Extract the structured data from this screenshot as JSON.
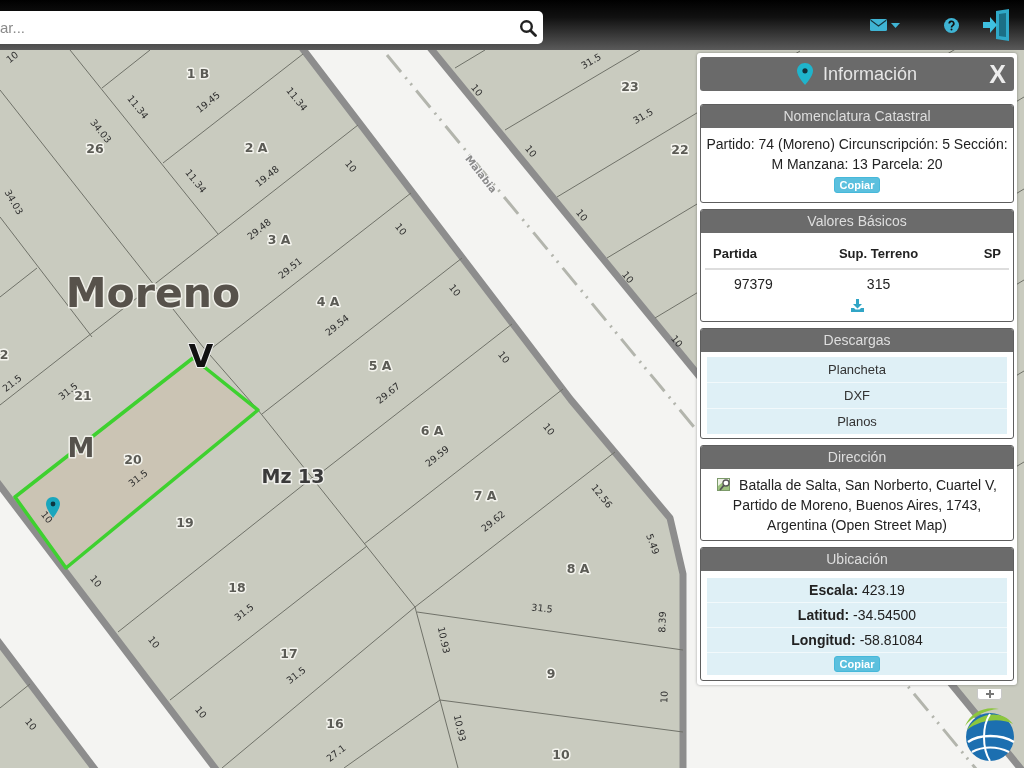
{
  "toolbar": {
    "search": {
      "placeholder": "ar..."
    }
  },
  "map": {
    "locality": "Moreno",
    "circumscription_label": "V",
    "section_label": "M",
    "block_label": "Mz 13",
    "street": "Malabia",
    "parcels": [
      {
        "number": "1 B",
        "selected": false
      },
      {
        "number": "23",
        "selected": false
      },
      {
        "number": "26",
        "selected": false
      },
      {
        "number": "2 A",
        "selected": false
      },
      {
        "number": "22",
        "selected": false
      },
      {
        "number": "3 A",
        "selected": false
      },
      {
        "number": "4 A",
        "selected": false
      },
      {
        "number": "2",
        "selected": false
      },
      {
        "number": "5 A",
        "selected": false
      },
      {
        "number": "21",
        "selected": false
      },
      {
        "number": "6 A",
        "selected": false
      },
      {
        "number": "20",
        "selected": true
      },
      {
        "number": "7 A",
        "selected": false
      },
      {
        "number": "19",
        "selected": false
      },
      {
        "number": "8 A",
        "selected": false
      },
      {
        "number": "18",
        "selected": false
      },
      {
        "number": "17",
        "selected": false
      },
      {
        "number": "9",
        "selected": false
      },
      {
        "number": "16",
        "selected": false
      },
      {
        "number": "10",
        "selected": false
      }
    ],
    "measures": [
      "10",
      "31.5",
      "10",
      "11.34",
      "19.45",
      "11.34",
      "31.5",
      "34.03",
      "10",
      "10",
      "19.48",
      "11.34",
      "34.03",
      "10",
      "29.48",
      "10",
      "29.51",
      "10",
      "10",
      "29.54",
      "10",
      "10",
      "21.5",
      "31.5",
      "29.67",
      "10",
      "29.59",
      "31.5",
      "10",
      "12.56",
      "29.62",
      "5.49",
      "10",
      "31.5",
      "31.5",
      "8.39",
      "10.93",
      "10",
      "31.5",
      "10",
      "10",
      "10",
      "10.93",
      "27.1"
    ]
  },
  "info_panel": {
    "title": "Información",
    "close": "X",
    "sections": [
      {
        "kind": "nomenclature",
        "title": "Nomenclatura Catastral",
        "text": "Partido: 74 (Moreno) Circunscripción: 5 Sección: M Manzana: 13 Parcela: 20",
        "button": "Copiar"
      },
      {
        "kind": "table",
        "title": "Valores Básicos",
        "columns": [
          "Partida",
          "Sup. Terreno",
          "SP"
        ],
        "rows": [
          [
            "97379",
            "315"
          ]
        ]
      },
      {
        "kind": "downloads",
        "title": "Descargas",
        "items": [
          "Plancheta",
          "DXF",
          "Planos"
        ]
      },
      {
        "kind": "address",
        "title": "Dirección",
        "text": "Batalla de Salta, San Norberto, Cuartel V, Partido de Moreno, Buenos Aires, 1743, Argentina (Open Street Map)"
      },
      {
        "kind": "location",
        "title": "Ubicación",
        "rows": [
          "**Escala:** 423.19",
          "**Latitud:** -34.54500",
          "**Longitud:** -58.81084"
        ],
        "button": "Copiar"
      }
    ]
  }
}
